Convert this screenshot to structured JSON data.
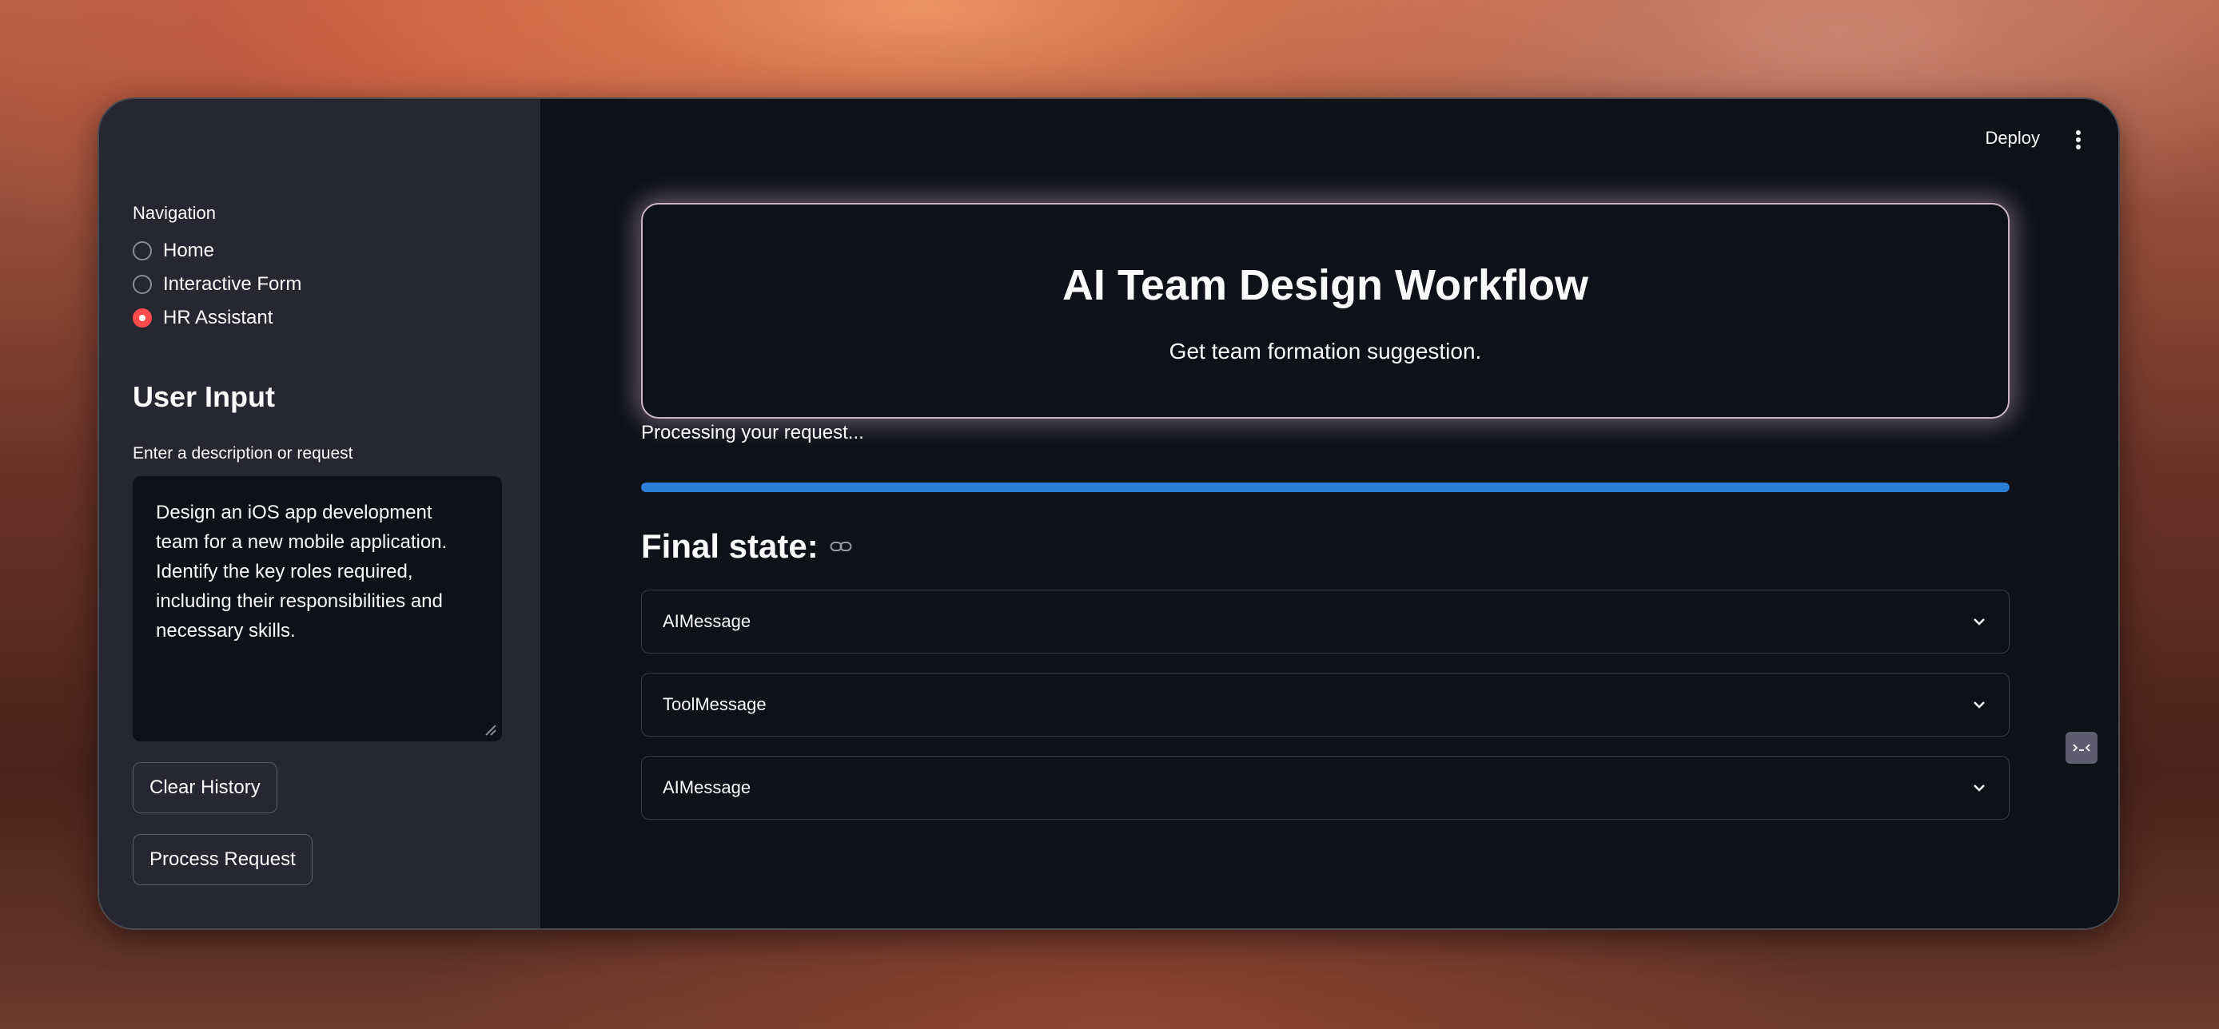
{
  "sidebar": {
    "nav_label": "Navigation",
    "nav_options": [
      {
        "label": "Home",
        "selected": false
      },
      {
        "label": "Interactive Form",
        "selected": false
      },
      {
        "label": "HR Assistant",
        "selected": true
      }
    ],
    "section_title": "User Input",
    "input_label": "Enter a description or request",
    "input_value": "Design an iOS app development team for a new mobile application. Identify the key roles required, including their responsibilities and necessary skills.",
    "clear_button": "Clear History",
    "process_button": "Process Request"
  },
  "header": {
    "deploy_label": "Deploy",
    "menu_icon": "kebab-menu-icon"
  },
  "main": {
    "hero_title": "AI Team Design Workflow",
    "hero_subtitle": "Get team formation suggestion.",
    "status_text": "Processing your request...",
    "progress_percent": 100,
    "final_heading": "Final state:",
    "expanders": [
      {
        "label": "AIMessage"
      },
      {
        "label": "ToolMessage"
      },
      {
        "label": "AIMessage"
      }
    ]
  },
  "colors": {
    "accent_red": "#ff4b4b",
    "progress_blue": "#2b7fd6",
    "sidebar_bg": "#262730",
    "main_bg": "#0e1117"
  }
}
